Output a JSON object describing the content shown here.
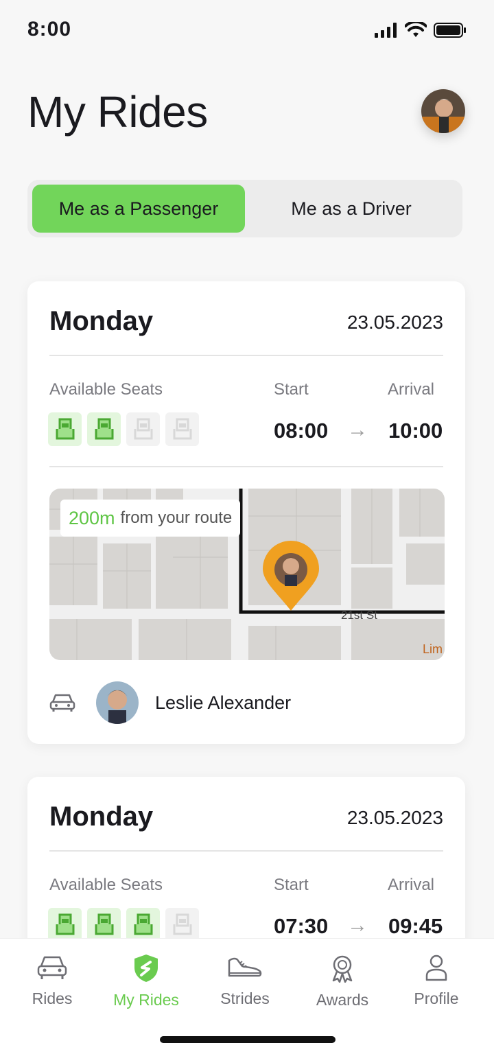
{
  "status_bar": {
    "time": "8:00"
  },
  "header": {
    "title": "My Rides"
  },
  "segment": {
    "passenger_label": "Me as a Passenger",
    "driver_label": "Me as a Driver",
    "active": "passenger"
  },
  "rides": [
    {
      "day": "Monday",
      "date": "23.05.2023",
      "seats_label": "Available Seats",
      "seats_taken": 2,
      "seats_total": 4,
      "start_label": "Start",
      "arrival_label": "Arrival",
      "start_time": "08:00",
      "arrival_time": "10:00",
      "distance": "200m",
      "distance_suffix": "from your route",
      "street_label": "21st St",
      "map_edge_label": "Lim",
      "driver_name": "Leslie Alexander"
    },
    {
      "day": "Monday",
      "date": "23.05.2023",
      "seats_label": "Available Seats",
      "seats_taken": 3,
      "seats_total": 4,
      "start_label": "Start",
      "arrival_label": "Arrival",
      "start_time": "07:30",
      "arrival_time": "09:45"
    }
  ],
  "tabbar": {
    "items": [
      {
        "label": "Rides",
        "icon": "car-icon"
      },
      {
        "label": "My Rides",
        "icon": "my-rides-icon"
      },
      {
        "label": "Strides",
        "icon": "shoe-icon"
      },
      {
        "label": "Awards",
        "icon": "award-icon"
      },
      {
        "label": "Profile",
        "icon": "profile-icon"
      }
    ],
    "active": "My Rides"
  },
  "colors": {
    "accent": "#72d55a",
    "pin": "#f0a020",
    "text": "#1a1a1f"
  }
}
